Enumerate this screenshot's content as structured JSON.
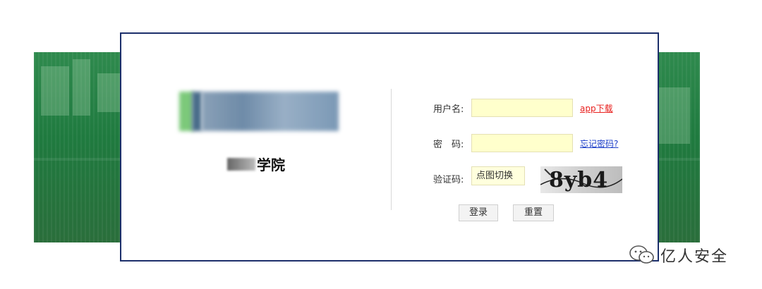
{
  "login": {
    "school_name": "学院",
    "username_label": "用户名:",
    "password_label": "密　码:",
    "captcha_label": "验证码:",
    "captcha_placeholder": "点图切换",
    "captcha_text": "8yb4",
    "app_download": "app下载",
    "forgot_password": "忘记密码?",
    "login_button": "登录",
    "reset_button": "重置"
  },
  "watermark": {
    "text": "亿人安全"
  },
  "colors": {
    "border": "#1c2f6b",
    "input_bg": "#ffffcc",
    "app_link": "#e8201e",
    "forgot_link": "#1a3cc8",
    "banner": "#2f8a4e"
  }
}
